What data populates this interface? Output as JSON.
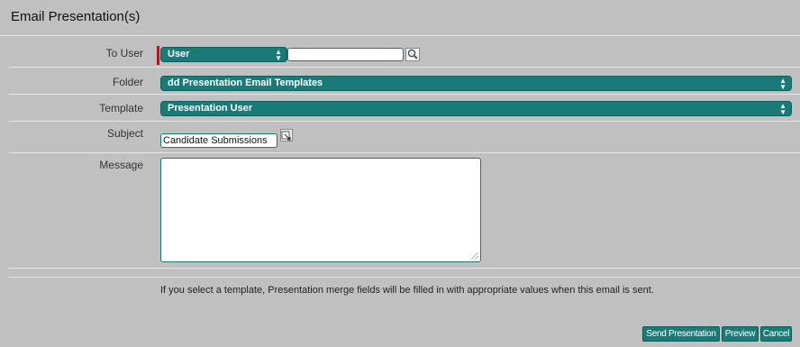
{
  "window": {
    "title": "Email Presentation(s)"
  },
  "form": {
    "to_user": {
      "label": "To User",
      "type_select": "User",
      "search_value": "",
      "lookup_icon": "magnifier-icon"
    },
    "folder": {
      "label": "Folder",
      "selected": "dd Presentation Email Templates"
    },
    "template": {
      "label": "Template",
      "selected": "Presentation User"
    },
    "subject": {
      "label": "Subject",
      "value": "Candidate Submissions",
      "edit_icon": "edit-field-icon"
    },
    "message": {
      "label": "Message",
      "value": ""
    },
    "hint": "If you select a template, Presentation merge fields will be filled in with appropriate values when this email is sent."
  },
  "buttons": {
    "send": "Send Presentation",
    "preview": "Preview",
    "cancel": "Cancel"
  },
  "colors": {
    "accent": "#1a7a78",
    "background": "#c0c0c0",
    "required": "#b01818"
  }
}
